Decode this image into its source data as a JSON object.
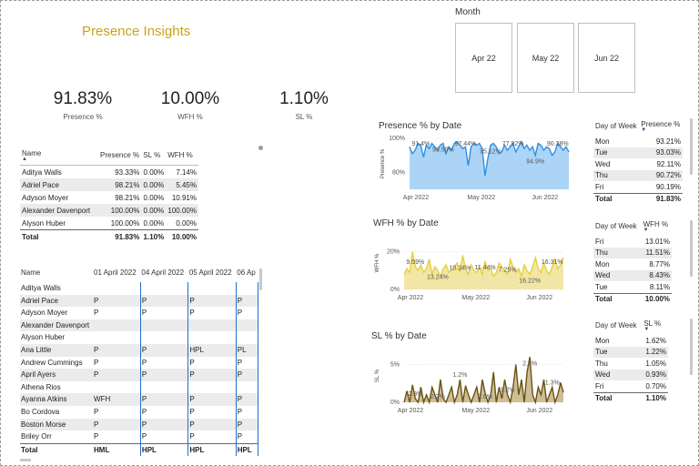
{
  "title": "Presence Insights",
  "kpis": [
    {
      "value": "91.83%",
      "label": "Presence %"
    },
    {
      "value": "10.00%",
      "label": "WFH %"
    },
    {
      "value": "1.10%",
      "label": "SL %"
    }
  ],
  "month_slicer": {
    "title": "Month",
    "options": [
      "Apr 22",
      "May 22",
      "Jun 22"
    ]
  },
  "summary_table": {
    "headers": [
      "Name",
      "Presence %",
      "SL %",
      "WFH %"
    ],
    "rows": [
      [
        "Aditya Walls",
        "93.33%",
        "0.00%",
        "7.14%"
      ],
      [
        "Adriel Pace",
        "98.21%",
        "0.00%",
        "5.45%"
      ],
      [
        "Adyson Moyer",
        "98.21%",
        "0.00%",
        "10.91%"
      ],
      [
        "Alexander Davenport",
        "100.00%",
        "0.00%",
        "100.00%"
      ],
      [
        "Alyson Huber",
        "100.00%",
        "0.00%",
        "0.00%"
      ]
    ],
    "total": [
      "Total",
      "91.83%",
      "1.10%",
      "10.00%"
    ]
  },
  "daily_table": {
    "headers": [
      "Name",
      "01 April 2022",
      "04 April 2022",
      "05 April 2022",
      "06 Ap"
    ],
    "rows": [
      [
        "Aditya Walls",
        "",
        "",
        "",
        ""
      ],
      [
        "Adriel Pace",
        "P",
        "P",
        "P",
        "P"
      ],
      [
        "Adyson Moyer",
        "P",
        "P",
        "P",
        "P"
      ],
      [
        "Alexander Davenport",
        "",
        "",
        "",
        ""
      ],
      [
        "Alyson Huber",
        "",
        "",
        "",
        ""
      ],
      [
        "Ana Little",
        "P",
        "P",
        "HPL",
        "PL"
      ],
      [
        "Andrew Cummings",
        "P",
        "P",
        "P",
        "P"
      ],
      [
        "April Ayers",
        "P",
        "P",
        "P",
        "P"
      ],
      [
        "Athena Rios",
        "",
        "",
        "",
        ""
      ],
      [
        "Ayanna Atkins",
        "WFH",
        "P",
        "P",
        "P"
      ],
      [
        "Bo Cordova",
        "P",
        "P",
        "P",
        "P"
      ],
      [
        "Boston Morse",
        "P",
        "P",
        "P",
        "P"
      ],
      [
        "Briley Orr",
        "P",
        "P",
        "P",
        "P"
      ]
    ],
    "total": [
      "Total",
      "HML",
      "HPL",
      "HPL",
      "HPL"
    ]
  },
  "presence_dow": {
    "headers": [
      "Day of Week",
      "Presence %"
    ],
    "rows": [
      [
        "Mon",
        "93.21%"
      ],
      [
        "Tue",
        "93.03%"
      ],
      [
        "Wed",
        "92.11%"
      ],
      [
        "Thu",
        "90.72%"
      ],
      [
        "Fri",
        "90.19%"
      ]
    ],
    "total": [
      "Total",
      "91.83%"
    ]
  },
  "wfh_dow": {
    "headers": [
      "Day of Week",
      "WFH %"
    ],
    "rows": [
      [
        "Fri",
        "13.01%"
      ],
      [
        "Thu",
        "11.51%"
      ],
      [
        "Mon",
        "8.77%"
      ],
      [
        "Wed",
        "8.43%"
      ],
      [
        "Tue",
        "8.11%"
      ]
    ],
    "total": [
      "Total",
      "10.00%"
    ]
  },
  "sl_dow": {
    "headers": [
      "Day of Week",
      "SL %"
    ],
    "rows": [
      [
        "Mon",
        "1.62%"
      ],
      [
        "Tue",
        "1.22%"
      ],
      [
        "Thu",
        "1.05%"
      ],
      [
        "Wed",
        "0.93%"
      ],
      [
        "Fri",
        "0.70%"
      ]
    ],
    "total": [
      "Total",
      "1.10%"
    ]
  },
  "chart_data": [
    {
      "type": "area",
      "title": "Presence % by Date",
      "ylabel": "Presence %",
      "xlabel": "",
      "color": "#2f8fe0",
      "fill": "#9ecdf4",
      "ylim": [
        70,
        100
      ],
      "yticks": [
        "80%",
        "100%"
      ],
      "ytick_values": [
        80,
        100
      ],
      "xticks": [
        "Apr 2022",
        "May 2022",
        "Jun 2022"
      ],
      "data_labels": [
        "91.4%",
        "93.59%",
        "97.44%",
        "95.12%",
        "77.92%",
        "94.9%",
        "90.38%"
      ],
      "values": [
        95,
        91,
        93,
        97,
        96,
        89,
        96,
        94,
        97,
        95,
        93,
        96,
        97,
        91,
        95,
        93,
        97,
        98,
        96,
        94,
        95,
        84,
        95,
        97,
        96,
        97,
        94,
        78,
        88,
        96,
        97,
        95,
        91,
        92,
        96,
        93,
        95,
        97,
        92,
        95,
        98,
        94,
        96,
        93,
        95,
        90,
        97,
        96,
        93,
        95,
        94,
        90,
        92,
        97,
        95,
        93,
        95,
        92
      ]
    },
    {
      "type": "area",
      "title": "WFH % by Date",
      "ylabel": "WFH %",
      "xlabel": "",
      "color": "#e6cf3e",
      "fill": "#f0e296",
      "ylim": [
        0,
        28
      ],
      "yticks": [
        "0%",
        "20%"
      ],
      "ytick_values": [
        0,
        20
      ],
      "xticks": [
        "Apr 2022",
        "May 2022",
        "Jun 2022"
      ],
      "data_labels": [
        "9.59%",
        "13.24%",
        "10.34%",
        "11.44%",
        "7.25%",
        "16.22%",
        "16.31%"
      ],
      "values": [
        8,
        11,
        9,
        20,
        12,
        10,
        13,
        9,
        11,
        16,
        8,
        12,
        10,
        7,
        11,
        13,
        9,
        10,
        12,
        14,
        9,
        18,
        11,
        8,
        13,
        10,
        9,
        12,
        8,
        15,
        10,
        11,
        7,
        9,
        14,
        12,
        10,
        8,
        16,
        12,
        9,
        11,
        7,
        13,
        10,
        8,
        12,
        17,
        11,
        9,
        14,
        10,
        8,
        12,
        16,
        11,
        13,
        17
      ]
    },
    {
      "type": "area",
      "title": "SL % by Date",
      "ylabel": "SL %",
      "xlabel": "",
      "color": "#6b5212",
      "fill": "#c6b386",
      "ylim": [
        0,
        7
      ],
      "yticks": [
        "0%",
        "5%"
      ],
      "ytick_values": [
        0,
        5
      ],
      "xticks": [
        "Apr 2022",
        "May 2022",
        "Jun 2022"
      ],
      "data_labels": [
        "2.3%",
        "2.2%",
        "1.2%",
        "2.6%",
        "1.2%",
        "2.6%",
        "1.3%"
      ],
      "values": [
        0,
        1.5,
        0,
        2.3,
        0.5,
        0,
        2,
        0,
        1,
        0,
        2,
        1,
        0,
        3,
        0.5,
        0,
        1,
        2,
        0,
        1,
        3,
        0,
        2.2,
        1,
        0,
        1,
        2,
        0,
        3,
        1.2,
        0,
        1,
        4,
        0,
        2,
        0.5,
        3,
        1,
        0,
        2,
        5,
        1,
        3,
        0,
        4,
        6,
        1,
        0,
        2,
        1,
        3,
        0,
        1,
        2,
        0,
        1,
        2.6,
        1.3
      ]
    }
  ]
}
